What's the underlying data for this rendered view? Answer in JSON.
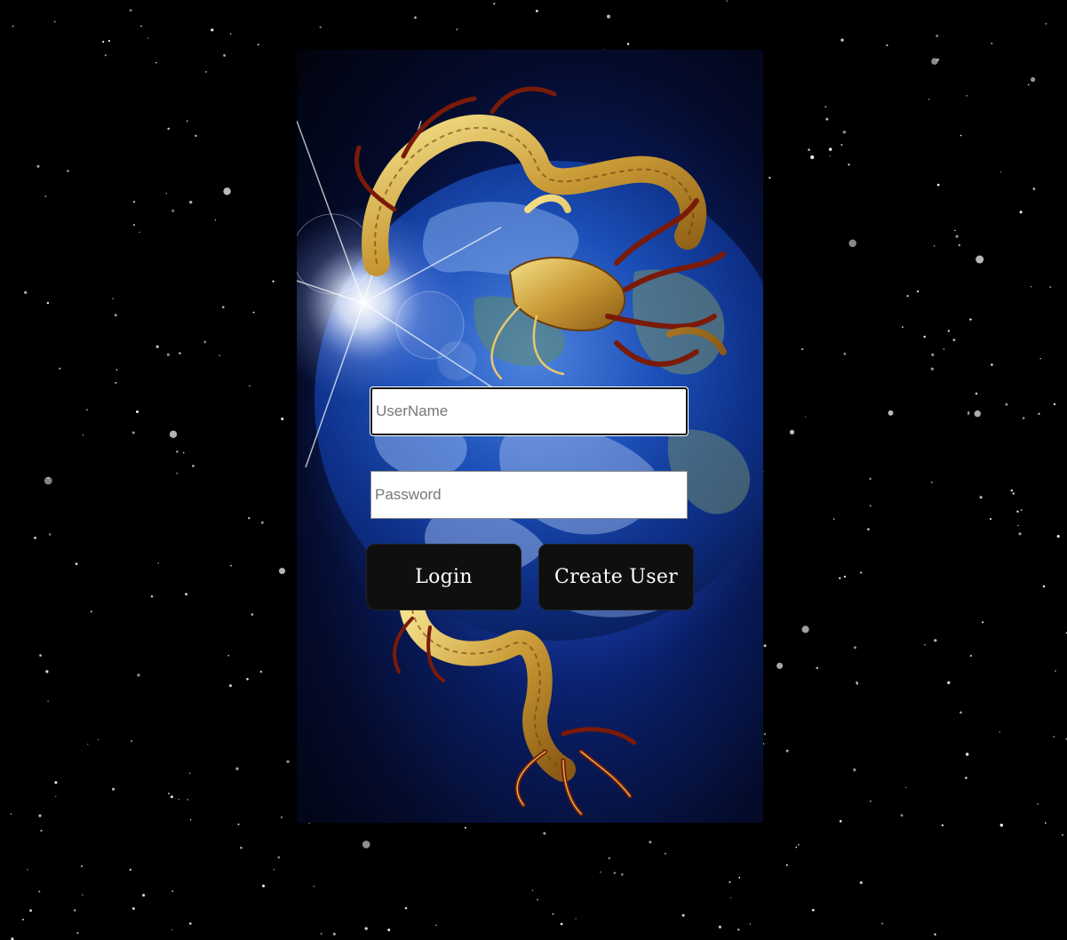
{
  "login_form": {
    "username_placeholder": "UserName",
    "password_placeholder": "Password",
    "login_label": "Login",
    "create_user_label": "Create User"
  },
  "background": {
    "page_color": "#000000",
    "panel_image": "dragon-around-earth",
    "icon": "dragon-earth-illustration"
  },
  "colors": {
    "button_bg": "#0f0f10",
    "button_text": "#ffffff",
    "field_bg": "#ffffff",
    "dragon_gold": "#d9b550",
    "dragon_red": "#6a1a0a",
    "earth_blue": "#1c4fb8"
  }
}
